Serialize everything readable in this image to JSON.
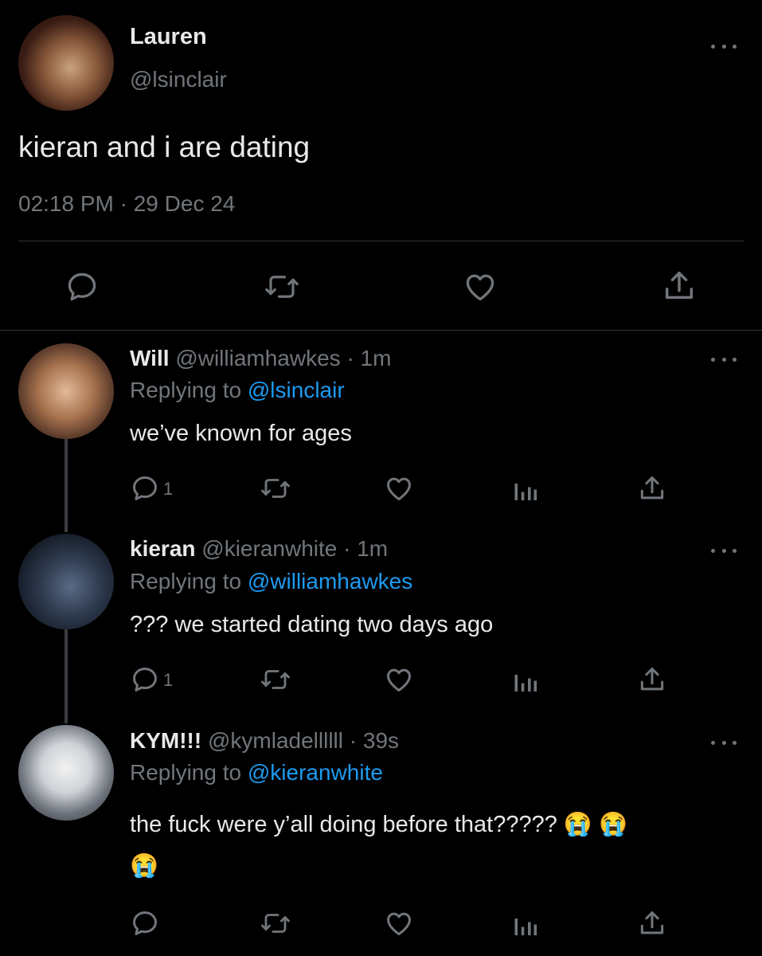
{
  "main_tweet": {
    "author_name": "Lauren",
    "handle": "@lsinclair",
    "text": "kieran and i are dating",
    "timestamp": "02:18 PM · 29 Dec 24"
  },
  "replies": [
    {
      "name": "Will",
      "handle_time": "@williamhawkes · 1m",
      "replying_prefix": "Replying to",
      "replying_to": "@lsinclair",
      "text": "we’ve known for ages",
      "reply_count": "1"
    },
    {
      "name": "kieran",
      "handle_time": "@kieranwhite · 1m",
      "replying_prefix": "Replying to",
      "replying_to": "@williamhawkes",
      "text": "??? we started dating two days ago",
      "reply_count": "1"
    },
    {
      "name": "KYM!!!",
      "handle_time": "@kymladellllll · 39s",
      "replying_prefix": "Replying to",
      "replying_to": "@kieranwhite",
      "text": "the fuck were y’all doing before that?????",
      "emoji": "😭 😭",
      "emoji2": "😭",
      "reply_count": ""
    }
  ],
  "colors": {
    "background": "#000000",
    "text": "#e7e9ea",
    "muted": "#71767b",
    "link": "#1d9bf0"
  },
  "icons": [
    "more-icon",
    "reply-icon",
    "retweet-icon",
    "like-icon",
    "share-icon",
    "views-icon"
  ]
}
